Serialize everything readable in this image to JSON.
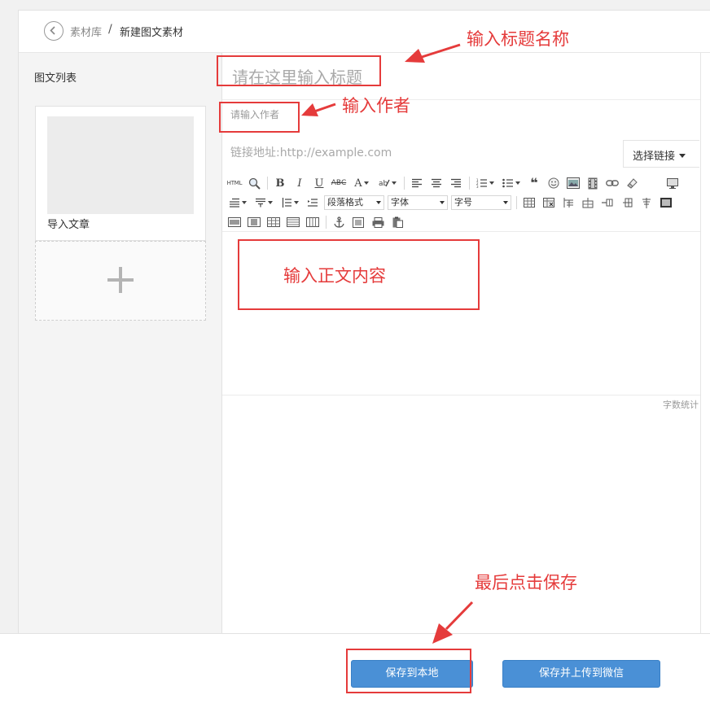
{
  "breadcrumb": {
    "library": "素材库",
    "separator": "/",
    "current": "新建图文素材"
  },
  "sidebar": {
    "title": "图文列表",
    "article": {
      "label": "导入文章"
    },
    "add_icon": "plus-icon"
  },
  "editor": {
    "title_placeholder": "请在这里输入标题",
    "author_placeholder": "请输入作者",
    "link_placeholder": "链接地址:http://example.com",
    "link_button": "选择链接",
    "toolbar": {
      "html_label": "HTML",
      "bold": "B",
      "italic": "I",
      "underline": "U",
      "strike": "ABC",
      "font_color": "A",
      "paragraph_select": "段落格式",
      "font_select": "字体",
      "size_select": "字号"
    },
    "word_count": "字数统计"
  },
  "actions": {
    "save_local": "保存到本地",
    "save_upload": "保存并上传到微信"
  },
  "annotations": {
    "title_hint": "输入标题名称",
    "author_hint": "输入作者",
    "body_hint": "输入正文内容",
    "save_hint": "最后点击保存",
    "color": "#e53b3b"
  },
  "colors": {
    "primary_button": "#4a90d6",
    "annotation": "#e53b3b"
  }
}
